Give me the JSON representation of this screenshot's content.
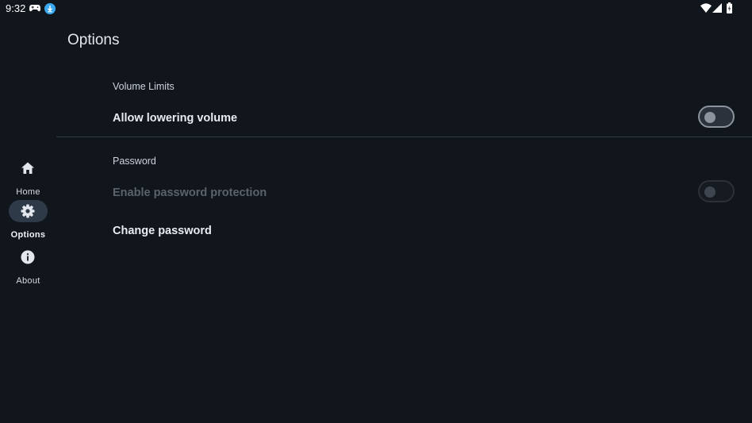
{
  "status_bar": {
    "time": "9:32",
    "icons": [
      "game-controller-icon",
      "download-icon",
      "wifi-icon",
      "cell-signal-icon",
      "battery-icon"
    ]
  },
  "nav": {
    "items": [
      {
        "label": "Home",
        "icon": "home-icon",
        "active": false
      },
      {
        "label": "Options",
        "icon": "gear-icon",
        "active": true
      },
      {
        "label": "About",
        "icon": "info-icon",
        "active": false
      }
    ]
  },
  "page": {
    "title": "Options"
  },
  "sections": [
    {
      "header": "Volume Limits",
      "prefs": [
        {
          "title": "Allow lowering volume",
          "type": "switch",
          "checked": false,
          "enabled": true
        }
      ]
    },
    {
      "header": "Password",
      "prefs": [
        {
          "title": "Enable password protection",
          "type": "switch",
          "checked": false,
          "enabled": false
        },
        {
          "title": "Change password",
          "type": "action",
          "enabled": true
        }
      ]
    }
  ],
  "colors": {
    "background": "#11151c",
    "nav_active_pill": "#2e3a48",
    "download_badge": "#3aa8f0",
    "divider": "#343a44"
  }
}
